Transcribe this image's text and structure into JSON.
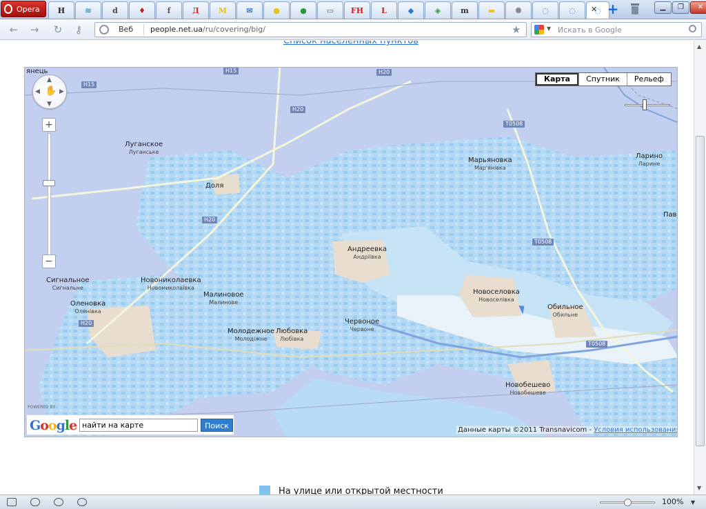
{
  "browser": {
    "menu_label": "Opera",
    "tabs": [
      {
        "glyph": "H",
        "color": "#222222"
      },
      {
        "glyph": "≋",
        "color": "#38a8d0"
      },
      {
        "glyph": "d",
        "color": "#4a4a4a"
      },
      {
        "glyph": "♦",
        "color": "#c0201c"
      },
      {
        "glyph": "f",
        "color": "#555555"
      },
      {
        "glyph": "Д",
        "color": "#d02c24"
      },
      {
        "glyph": "M",
        "color": "#e6c21a"
      },
      {
        "glyph": "✉",
        "color": "#4a7fc8"
      },
      {
        "glyph": "●",
        "color": "#e2c21a"
      },
      {
        "glyph": "●",
        "color": "#2a9a3a"
      },
      {
        "glyph": "▭",
        "color": "#5a6a7e"
      },
      {
        "glyph": "FH",
        "color": "#c81e1e"
      },
      {
        "glyph": "L",
        "color": "#c81e1e"
      },
      {
        "glyph": "◆",
        "color": "#2a7ad0"
      },
      {
        "glyph": "◈",
        "color": "#2f9a3c"
      },
      {
        "glyph": "m",
        "color": "#333333"
      },
      {
        "glyph": "▬",
        "color": "#f0c21a"
      },
      {
        "glyph": "✺",
        "color": "#888888"
      },
      {
        "glyph": "◌",
        "color": "#2a7ad0"
      },
      {
        "glyph": "◌",
        "color": "#2a7ad0"
      },
      {
        "glyph": "◌",
        "color": "#2a7ad0",
        "active": true
      }
    ],
    "address": {
      "scheme_label": "Веб",
      "url_host": "people.net.ua",
      "url_path": "/ru/covering/big/"
    },
    "search_placeholder": "Искать в Google"
  },
  "page": {
    "top_link": "Список населенных пунктов",
    "legend_label": "На улице или открытой местности",
    "legend_color": "#7fc1ee"
  },
  "map": {
    "types": [
      "Карта",
      "Спутник",
      "Рельеф"
    ],
    "search_logo": "Google",
    "search_value": "найти на карте",
    "search_button": "Поиск",
    "powered_by": "POWERED BY",
    "attribution_text": "Данные карты ©2011 Transnavicom - ",
    "attribution_link": "Условия использования",
    "edge_labels": [
      "янець",
      "Пав"
    ],
    "places": [
      {
        "ru": "Луганское",
        "ua": "Луганське"
      },
      {
        "ru": "Доля",
        "ua": ""
      },
      {
        "ru": "Марьяновка",
        "ua": "Мар'янівка"
      },
      {
        "ru": "Ларино",
        "ua": "Ларине"
      },
      {
        "ru": "Андреевка",
        "ua": "Андріївка"
      },
      {
        "ru": "Новоселовка",
        "ua": "Новоселівка"
      },
      {
        "ru": "Обильное",
        "ua": "Обильне"
      },
      {
        "ru": "Сигнальное",
        "ua": "Сигнальне"
      },
      {
        "ru": "Новониколаевка",
        "ua": "Новомиколаївка"
      },
      {
        "ru": "Малиновое",
        "ua": "Малинове"
      },
      {
        "ru": "Оленовка",
        "ua": "Оленівка"
      },
      {
        "ru": "Молодежное",
        "ua": "Молодіжне"
      },
      {
        "ru": "Любовка",
        "ua": "Любівка"
      },
      {
        "ru": "Червоное",
        "ua": "Червоне"
      },
      {
        "ru": "Новобешево",
        "ua": "Новобешеве"
      }
    ],
    "roads": [
      "H15",
      "H15",
      "H20",
      "H20",
      "H20",
      "T0508",
      "T0508",
      "T0508",
      "H20"
    ]
  },
  "status": {
    "zoom_level": "100%"
  }
}
